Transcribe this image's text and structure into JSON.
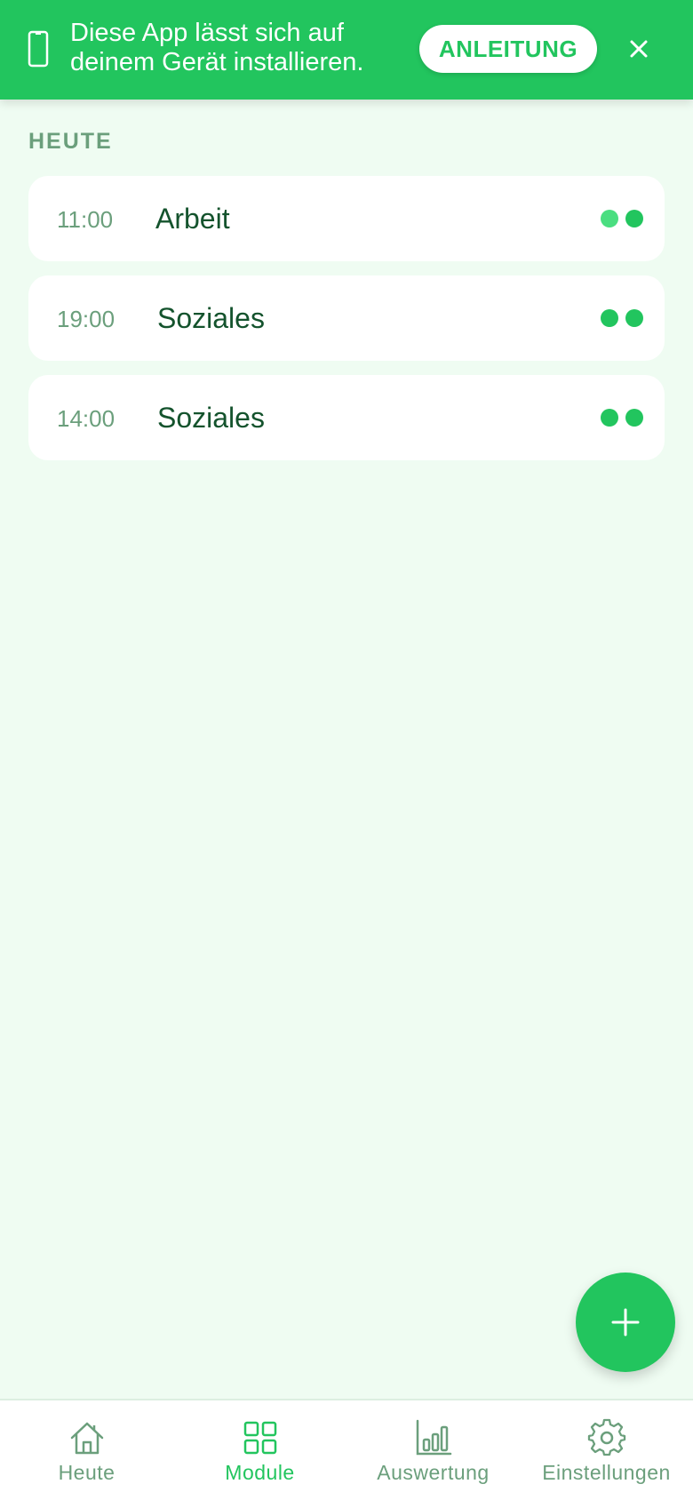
{
  "colors": {
    "accent": "#22c55e",
    "accent_light": "#4ade80",
    "background": "#effcf2",
    "muted_text": "#6b9f7c",
    "title_text": "#14532d"
  },
  "banner": {
    "icon": "smartphone-icon",
    "text": "Diese App lässt sich auf deinem Gerät installieren.",
    "button_label": "ANLEITUNG",
    "close_icon": "close-icon"
  },
  "today": {
    "label": "HEUTE",
    "entries": [
      {
        "time": "11:00",
        "title": "Arbeit"
      },
      {
        "time": "19:00",
        "title": "Soziales"
      },
      {
        "time": "14:00",
        "title": "Soziales"
      }
    ]
  },
  "fab": {
    "icon": "plus-icon"
  },
  "nav": {
    "items": [
      {
        "label": "Heute",
        "icon": "home-icon"
      },
      {
        "label": "Module",
        "icon": "grid-icon",
        "active": true
      },
      {
        "label": "Auswertung",
        "icon": "bar-chart-icon"
      },
      {
        "label": "Einstellungen",
        "icon": "gear-icon"
      }
    ]
  }
}
